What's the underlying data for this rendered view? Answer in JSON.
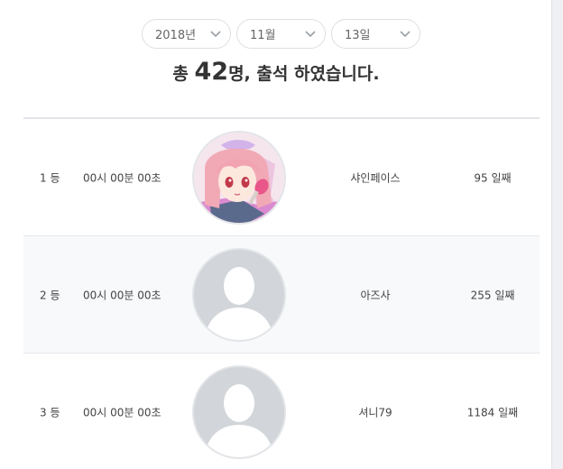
{
  "date_filters": {
    "year": "2018년",
    "month": "11월",
    "day": "13일"
  },
  "summary": {
    "prefix": "총",
    "count": "42",
    "suffix": "명, 출석 하였습니다."
  },
  "rows": [
    {
      "rank": "1 등",
      "time": "00시 00분 00초",
      "avatar": "anime-character-avatar",
      "name": "샤인페이스",
      "days": "95 일째"
    },
    {
      "rank": "2 등",
      "time": "00시 00분 00초",
      "avatar": "default-user-avatar",
      "name": "아즈사",
      "days": "255 일째"
    },
    {
      "rank": "3 등",
      "time": "00시 00분 00초",
      "avatar": "default-user-avatar",
      "name": "셔니79",
      "days": "1184 일째"
    }
  ],
  "colors": {
    "row_alt_bg": "#f7f9fb",
    "avatar_placeholder": "#d2d5d9",
    "text": "#333333"
  }
}
